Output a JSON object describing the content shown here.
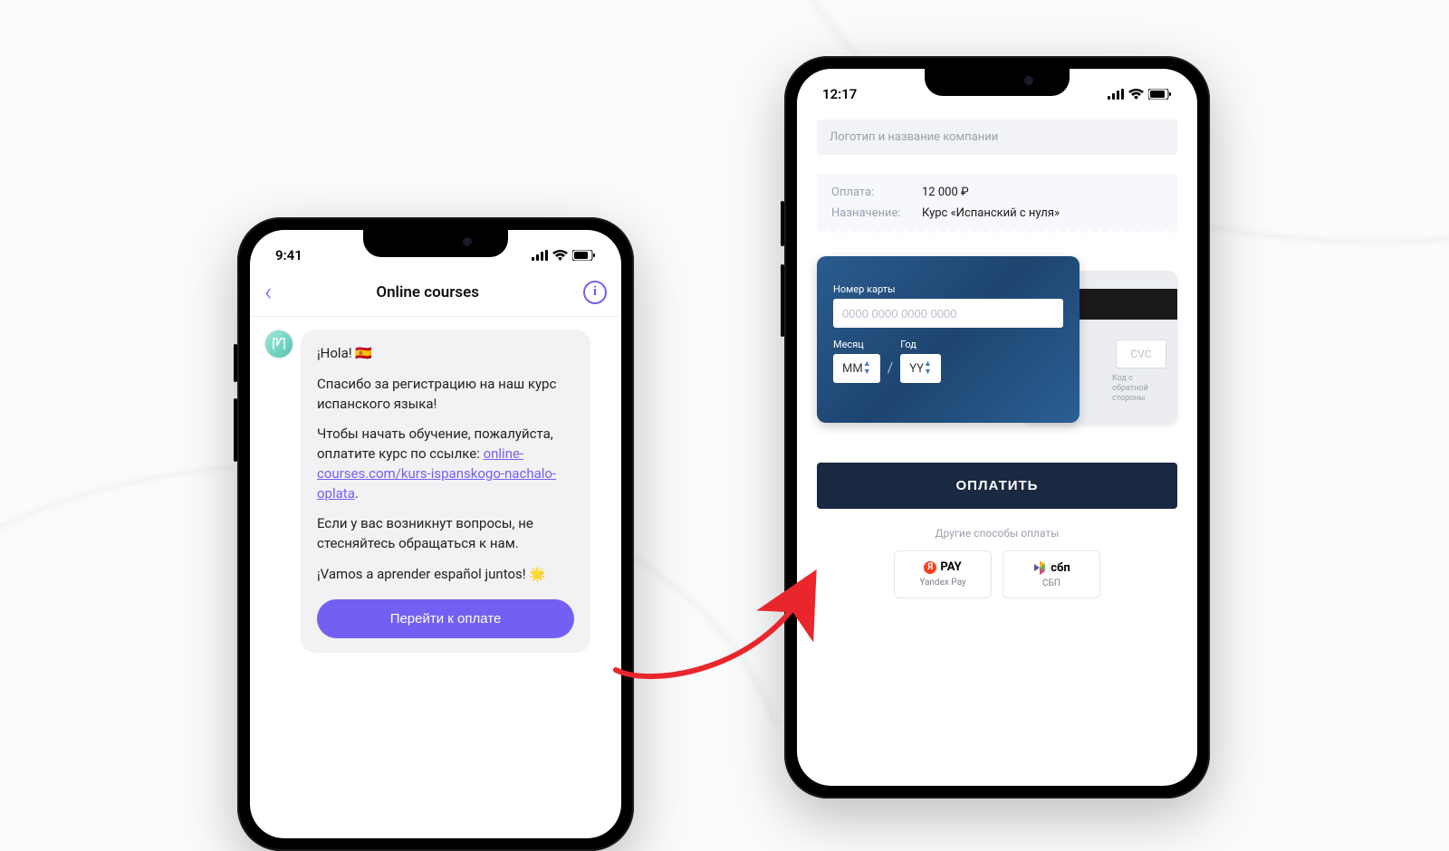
{
  "left": {
    "status_time": "9:41",
    "chat_title": "Online courses",
    "msg": {
      "greeting": "¡Hola! 🇪🇸",
      "p1": "Спасибо за регистрацию на наш курс испанского языка!",
      "p2_before_link": "Чтобы начать обучение, пожалуйста, оплатите курс по ссылке: ",
      "link_text": "online-courses.com/kurs-ispanskogo-nachalo-oplata",
      "p2_after_link": ".",
      "p3": "Если у вас возникнут вопросы, не стесняйтесь обращаться к нам.",
      "p4": "¡Vamos a aprender español juntos! 🌟"
    },
    "cta": "Перейти к оплате"
  },
  "right": {
    "status_time": "12:17",
    "logo_placeholder": "Логотип и название компании",
    "summary": {
      "k_amount": "Оплата:",
      "v_amount": "12 000 ₽",
      "k_purpose": "Назначение:",
      "v_purpose": "Курс «Испанский с нуля»"
    },
    "card": {
      "number_label": "Номер карты",
      "number_placeholder": "0000 0000 0000 0000",
      "month_label": "Месяц",
      "month_placeholder": "MM",
      "year_label": "Год",
      "year_placeholder": "YY",
      "cvc_placeholder": "CVC",
      "cvc_hint": "Код с обратной стороны"
    },
    "pay_button": "ОПЛАТИТЬ",
    "alt_label": "Другие способы оплаты",
    "alt": {
      "yapay_logo": "PAY",
      "yapay_name": "Yandex Pay",
      "sbp_logo": "сбп",
      "sbp_name": "СБП"
    }
  }
}
